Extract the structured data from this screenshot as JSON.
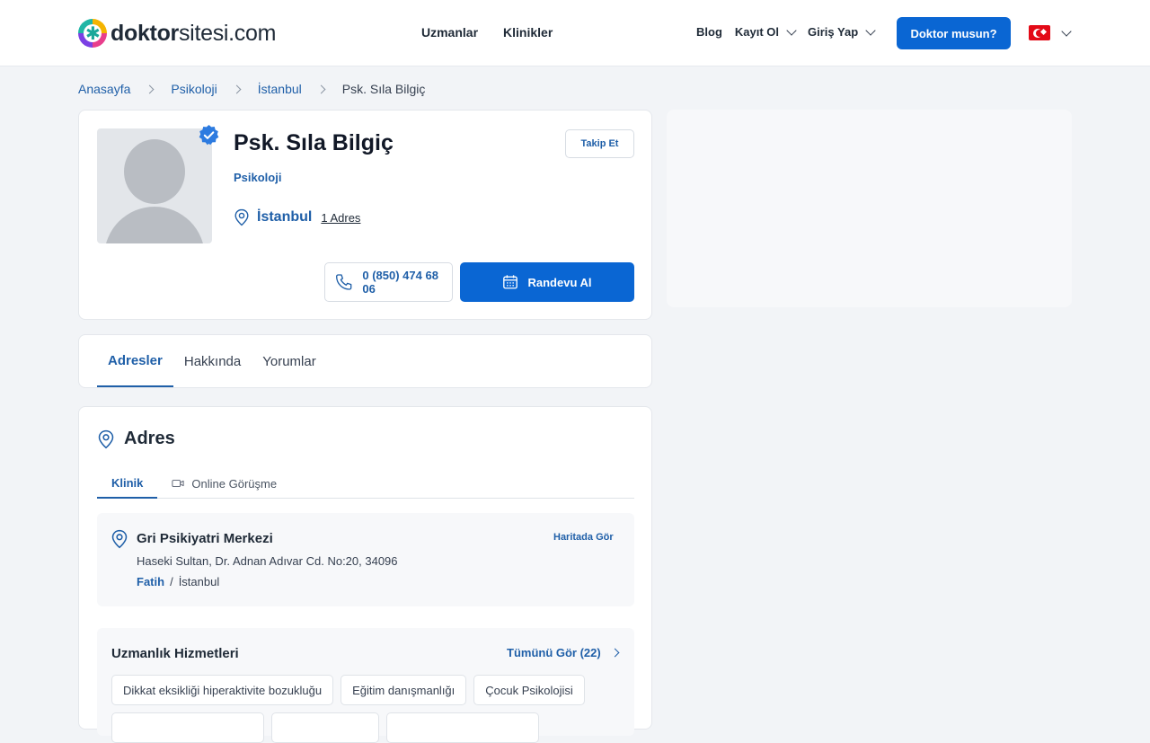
{
  "header": {
    "logo_bold": "doktor",
    "logo_light": "sitesi.com",
    "nav_center": [
      "Uzmanlar",
      "Klinikler"
    ],
    "blog": "Blog",
    "register": "Kayıt Ol",
    "login": "Giriş Yap",
    "doctor_cta": "Doktor musun?"
  },
  "breadcrumb": [
    "Anasayfa",
    "Psikoloji",
    "İstanbul",
    "Psk. Sıla Bilgiç"
  ],
  "profile": {
    "name": "Psk. Sıla Bilgiç",
    "specialty": "Psikoloji",
    "city": "İstanbul",
    "address_count": "1 Adres",
    "follow": "Takip Et",
    "phone": "0 (850) 474 68 06",
    "appointment": "Randevu Al"
  },
  "tabs": [
    "Adresler",
    "Hakkında",
    "Yorumlar"
  ],
  "address": {
    "title": "Adres",
    "tab_clinic": "Klinik",
    "tab_online": "Online Görüşme",
    "clinic_name": "Gri Psikiyatri Merkezi",
    "street": "Haseki Sultan, Dr. Adnan Adıvar Cd. No:20, 34096",
    "district": "Fatih",
    "separator": "/",
    "city": "İstanbul",
    "map_link": "Haritada Gör"
  },
  "services": {
    "title": "Uzmanlık Hizmetleri",
    "see_all": "Tümünü Gör (22)",
    "items": [
      "Dikkat eksikliği hiperaktivite bozukluğu",
      "Eğitim danışmanlığı",
      "Çocuk Psikolojisi"
    ]
  },
  "colors": {
    "primary": "#0a66d3",
    "link": "#1f5fa8",
    "flag": "#e30a17"
  }
}
